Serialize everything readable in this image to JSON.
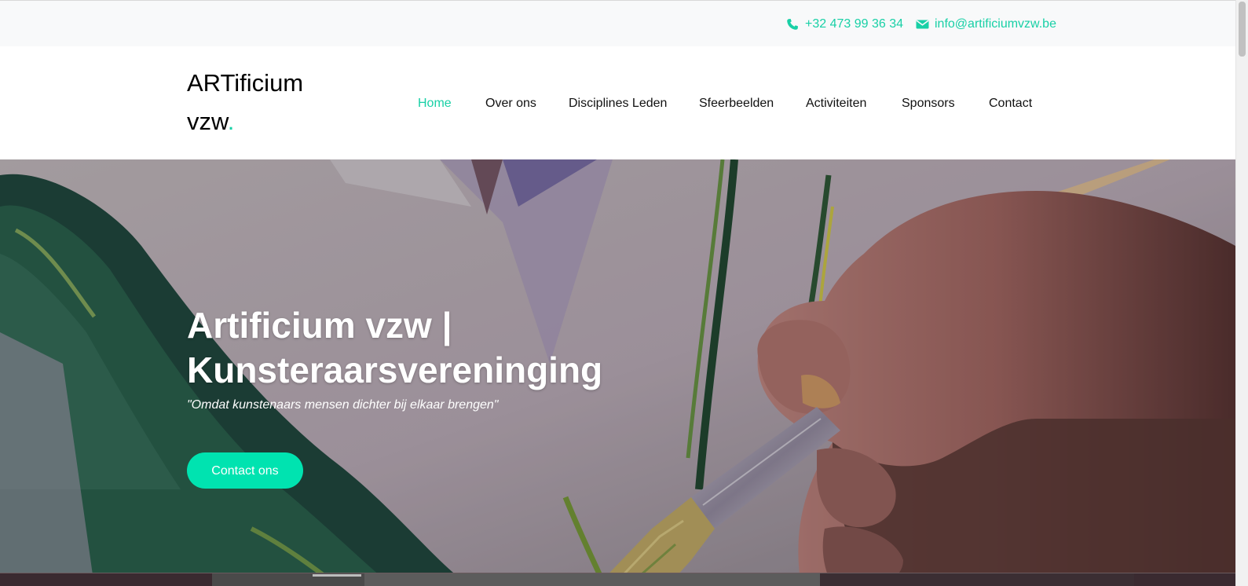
{
  "topbar": {
    "phone": "+32 473 99 36 34",
    "email": "info@artificiumvzw.be",
    "phone_icon": "phone-icon",
    "email_icon": "envelope-icon"
  },
  "header": {
    "logo_line1": "ARTificium",
    "logo_line2": "vzw",
    "logo_dot": "."
  },
  "nav": {
    "items": [
      {
        "label": "Home",
        "active": true
      },
      {
        "label": "Over ons",
        "active": false
      },
      {
        "label": "Disciplines Leden",
        "active": false
      },
      {
        "label": "Sfeerbeelden",
        "active": false
      },
      {
        "label": "Activiteiten",
        "active": false
      },
      {
        "label": "Sponsors",
        "active": false
      },
      {
        "label": "Contact",
        "active": false
      }
    ]
  },
  "hero": {
    "title_line1": "Artificium vzw |",
    "title_line2": "Kunsteraarsvereninging",
    "subtitle": "\"Omdat kunstenaars mensen dichter bij elkaar brengen\"",
    "button_label": "Contact ons",
    "image": "painting-hand-brush"
  },
  "colors": {
    "accent": "#18d0a6",
    "button": "#00e3b0",
    "topbar_bg": "#f8f9fa",
    "text": "#111111"
  }
}
